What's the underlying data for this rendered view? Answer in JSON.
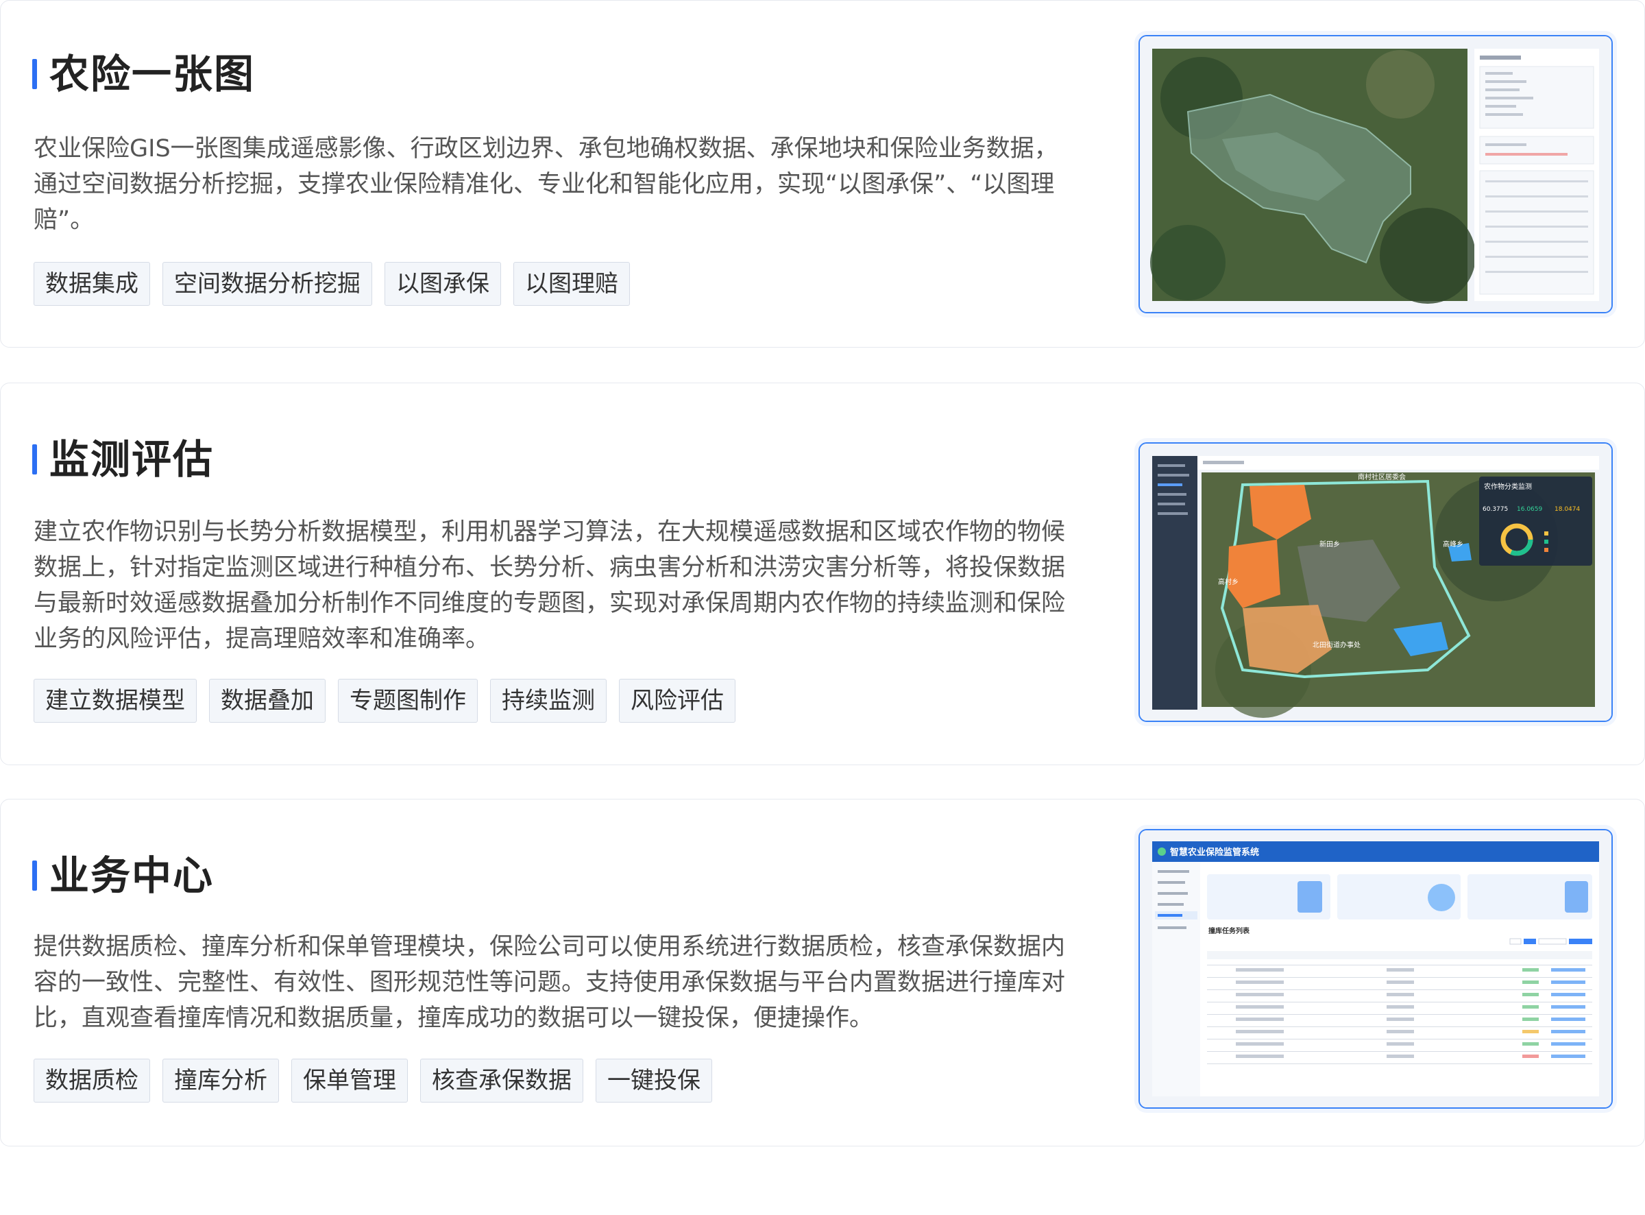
{
  "sections": [
    {
      "title": "农险一张图",
      "description": "农业保险GIS一张图集成遥感影像、行政区划边界、承包地确权数据、承保地块和保险业务数据，通过空间数据分析挖掘，支撑农业保险精准化、专业化和智能化应用，实现“以图承保”、“以图理赔”。",
      "tags": [
        "数据集成",
        "空间数据分析挖掘",
        "以图承保",
        "以图理赔"
      ]
    },
    {
      "title": "监测评估",
      "description": "建立农作物识别与长势分析数据模型，利用机器学习算法，在大规模遥感数据和区域农作物的物候数据上，针对指定监测区域进行种植分布、长势分析、病虫害分析和洪涝灾害分析等，将投保数据与最新时效遥感数据叠加分析制作不同维度的专题图，实现对承保周期内农作物的持续监测和保险业务的风险评估，提高理赔效率和准确率。",
      "tags": [
        "建立数据模型",
        "数据叠加",
        "专题图制作",
        "持续监测",
        "风险评估"
      ]
    },
    {
      "title": "业务中心",
      "description": "提供数据质检、撞库分析和保单管理模块，保险公司可以使用系统进行数据质检，核查承保数据内容的一致性、完整性、有效性、图形规范性等问题。支持使用承保数据与平台内置数据进行撞库对比，直观查看撞库情况和数据质量，撞库成功的数据可以一键投保，便捷操作。",
      "tags": [
        "数据质检",
        "撞库分析",
        "保单管理",
        "核查承保数据",
        "一键投保"
      ]
    }
  ],
  "screenshots": {
    "monitor": {
      "labels": [
        "南村社区居委会",
        "新田乡",
        "高村乡",
        "高峰乡",
        "北田街道办事处"
      ],
      "panel_title": "农作物分类监测",
      "stat_a": "60.3775",
      "stat_b": "16.0659",
      "stat_c": "18.0474"
    },
    "business": {
      "system_title": "智慧农业保险监管系统",
      "list_title": "撞库任务列表"
    }
  },
  "colors": {
    "accent": "#2c6ff3",
    "frame": "#3a82f7"
  }
}
